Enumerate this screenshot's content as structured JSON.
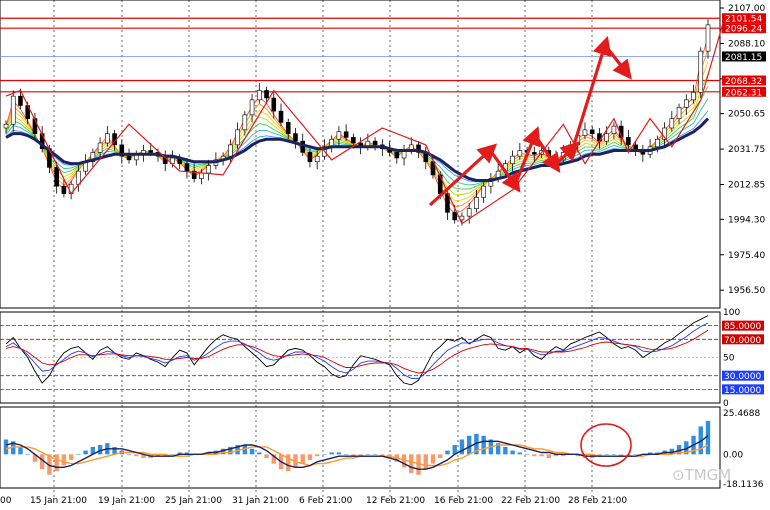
{
  "colors": {
    "background": "#ffffff",
    "panel_bg": "#ffffff",
    "grid": "#000000",
    "candles": "#000000",
    "resistance": "#e60000",
    "annotation": "#e31b1b",
    "current_line": "#6a8cff",
    "current_tag_bg": "#000000",
    "ema_main": "#1c2360",
    "rsi_line": "#000000",
    "rsi_signal_blue": "#1e3cff",
    "rsi_signal_red": "#d40000",
    "level_red": "#d40000",
    "level_blue": "#1e3cff",
    "hist_pos": "#2e8fe0",
    "hist_neg": "#f59a6b",
    "macd_line": "#1c2360",
    "macd_signal": "#ff9a2e"
  },
  "chart_data": [
    {
      "type": "candlestick",
      "panel": "price",
      "x_labels": [
        "15 Jan 21:00",
        "19 Jan 21:00",
        "25 Jan 21:00",
        "31 Jan 21:00",
        "6 Feb 21:00",
        "12 Feb 21:00",
        "16 Feb 21:00",
        "22 Feb 21:00",
        "28 Feb 21:00"
      ],
      "y_ticks": [
        "2107.00",
        "2088.10",
        "2069.20",
        "2050.65",
        "2031.75",
        "2012.85",
        "1994.30",
        "1975.40",
        "1956.50"
      ],
      "ylim": [
        1947.0,
        2107.0
      ],
      "horizontal_levels": [
        {
          "label": "2101.54",
          "value": 2101.54,
          "color": "#e60000"
        },
        {
          "label": "2096.24",
          "value": 2096.24,
          "color": "#e60000"
        },
        {
          "label": "2068.32",
          "value": 2068.32,
          "color": "#e60000"
        },
        {
          "label": "2062.31",
          "value": 2062.31,
          "color": "#e60000"
        }
      ],
      "current_price": {
        "label": "2081.15",
        "value": 2081.15
      },
      "close_path": [
        2045,
        2060,
        2055,
        2048,
        2040,
        2032,
        2022,
        2012,
        2008,
        2013,
        2020,
        2025,
        2030,
        2035,
        2040,
        2034,
        2028,
        2026,
        2029,
        2031,
        2030,
        2028,
        2024,
        2027,
        2024,
        2020,
        2016,
        2019,
        2023,
        2026,
        2028,
        2034,
        2042,
        2050,
        2058,
        2063,
        2059,
        2052,
        2046,
        2040,
        2036,
        2030,
        2025,
        2028,
        2033,
        2037,
        2041,
        2038,
        2035,
        2033,
        2036,
        2034,
        2032,
        2030,
        2027,
        2031,
        2034,
        2030,
        2025,
        2018,
        2008,
        1998,
        1994,
        1996,
        2000,
        2006,
        2012,
        2016,
        2020,
        2024,
        2028,
        2031,
        2030,
        2029,
        2031,
        2028,
        2026,
        2030,
        2034,
        2039,
        2042,
        2040,
        2036,
        2040,
        2044,
        2038,
        2034,
        2031,
        2029,
        2033,
        2037,
        2043,
        2048,
        2054,
        2058,
        2062,
        2084,
        2098
      ],
      "ema_main": [
        2038,
        2040,
        2040,
        2039,
        2037,
        2034,
        2031,
        2028,
        2025,
        2024,
        2024,
        2025,
        2026,
        2027,
        2028,
        2029,
        2029,
        2029,
        2029,
        2029,
        2029,
        2029,
        2028,
        2028,
        2027,
        2026,
        2025,
        2025,
        2025,
        2025,
        2026,
        2027,
        2029,
        2031,
        2034,
        2036,
        2037,
        2037,
        2037,
        2036,
        2035,
        2034,
        2033,
        2032,
        2032,
        2033,
        2033,
        2033,
        2033,
        2033,
        2033,
        2033,
        2033,
        2032,
        2031,
        2031,
        2031,
        2031,
        2030,
        2028,
        2026,
        2023,
        2020,
        2018,
        2016,
        2015,
        2015,
        2015,
        2016,
        2017,
        2019,
        2020,
        2021,
        2022,
        2023,
        2023,
        2023,
        2024,
        2025,
        2026,
        2028,
        2029,
        2029,
        2030,
        2031,
        2031,
        2031,
        2031,
        2031,
        2031,
        2032,
        2033,
        2035,
        2037,
        2039,
        2041,
        2044,
        2048
      ],
      "zigzag": [
        [
          0,
          2060
        ],
        [
          2,
          2063
        ],
        [
          9,
          2008
        ],
        [
          17,
          2045
        ],
        [
          24,
          2020
        ],
        [
          30,
          2018
        ],
        [
          37,
          2063
        ],
        [
          45,
          2026
        ],
        [
          52,
          2043
        ],
        [
          58,
          2034
        ],
        [
          63,
          1992
        ],
        [
          70,
          2010
        ],
        [
          77,
          2045
        ],
        [
          80,
          2024
        ],
        [
          84,
          2048
        ],
        [
          86,
          2030
        ],
        [
          89,
          2048
        ],
        [
          92,
          2033
        ],
        [
          96,
          2058
        ],
        [
          99,
          2098
        ]
      ]
    },
    {
      "type": "line",
      "panel": "oscillator",
      "y_ticks": [
        "100",
        "50",
        "0"
      ],
      "ylim": [
        0,
        100
      ],
      "levels": [
        {
          "label": "85.0000",
          "value": 85,
          "color": "#d40000"
        },
        {
          "label": "70.0000",
          "value": 70,
          "color": "#d40000"
        },
        {
          "label": "30.0000",
          "value": 30,
          "color": "#1e3cff"
        },
        {
          "label": "15.0000",
          "value": 15,
          "color": "#1e3cff"
        }
      ],
      "series": [
        {
          "values": [
            65,
            72,
            60,
            50,
            35,
            22,
            30,
            45,
            55,
            60,
            62,
            55,
            48,
            58,
            62,
            55,
            50,
            48,
            55,
            52,
            48,
            45,
            40,
            50,
            58,
            55,
            42,
            52,
            62,
            70,
            75,
            72,
            70,
            62,
            55,
            48,
            40,
            42,
            50,
            58,
            60,
            58,
            52,
            45,
            40,
            32,
            28,
            30,
            42,
            52,
            50,
            48,
            45,
            42,
            30,
            22,
            20,
            25,
            40,
            55,
            62,
            70,
            68,
            72,
            65,
            70,
            75,
            72,
            60,
            58,
            62,
            55,
            60,
            52,
            48,
            56,
            62,
            58,
            65,
            68,
            72,
            75,
            78,
            72,
            65,
            60,
            62,
            58,
            50,
            55,
            60,
            66,
            70,
            76,
            82,
            88,
            92,
            96
          ],
          "color": "#000000"
        },
        {
          "values": [
            62,
            66,
            60,
            53,
            44,
            35,
            36,
            42,
            48,
            54,
            57,
            55,
            51,
            54,
            57,
            55,
            52,
            50,
            52,
            51,
            49,
            47,
            44,
            47,
            51,
            52,
            47,
            50,
            55,
            61,
            66,
            68,
            68,
            65,
            60,
            55,
            49,
            47,
            49,
            53,
            56,
            56,
            54,
            50,
            46,
            40,
            35,
            33,
            37,
            44,
            46,
            46,
            45,
            44,
            38,
            31,
            27,
            27,
            33,
            42,
            50,
            58,
            62,
            66,
            66,
            68,
            70,
            70,
            66,
            63,
            62,
            59,
            59,
            56,
            53,
            54,
            57,
            57,
            60,
            63,
            66,
            69,
            72,
            71,
            68,
            65,
            64,
            62,
            57,
            56,
            57,
            60,
            63,
            68,
            73,
            79,
            84,
            88
          ],
          "color": "#1e3cff"
        },
        {
          "values": [
            60,
            62,
            60,
            56,
            50,
            44,
            42,
            43,
            46,
            50,
            53,
            53,
            52,
            53,
            54,
            54,
            53,
            52,
            52,
            52,
            51,
            50,
            48,
            48,
            49,
            50,
            49,
            49,
            51,
            55,
            59,
            62,
            64,
            64,
            62,
            59,
            55,
            52,
            51,
            52,
            53,
            54,
            53,
            52,
            50,
            46,
            42,
            39,
            39,
            41,
            43,
            44,
            44,
            44,
            42,
            38,
            35,
            33,
            34,
            37,
            42,
            48,
            53,
            57,
            60,
            62,
            64,
            65,
            64,
            63,
            62,
            60,
            60,
            58,
            56,
            56,
            56,
            56,
            57,
            59,
            61,
            64,
            66,
            67,
            66,
            65,
            64,
            63,
            61,
            59,
            59,
            59,
            60,
            63,
            66,
            70,
            75,
            80
          ],
          "color": "#d40000"
        }
      ]
    },
    {
      "type": "bar",
      "panel": "macd",
      "y_ticks": [
        "25.4688",
        "0.00",
        "-18.1136"
      ],
      "ylim": [
        -18.1136,
        25.4688
      ],
      "histogram": [
        8,
        7,
        4,
        0,
        -4,
        -8,
        -11,
        -9,
        -6,
        -3,
        0,
        2,
        4,
        5,
        6,
        4,
        2,
        0,
        -1,
        -2,
        -2,
        -1,
        -1,
        0,
        1,
        1,
        0,
        0,
        1,
        2,
        3,
        4,
        5,
        5,
        3,
        1,
        -2,
        -5,
        -8,
        -9,
        -7,
        -5,
        -3,
        -1,
        0,
        1,
        1,
        0,
        -1,
        -1,
        0,
        0,
        -1,
        -2,
        -4,
        -7,
        -10,
        -11,
        -8,
        -5,
        -2,
        2,
        5,
        8,
        10,
        11,
        10,
        8,
        6,
        4,
        2,
        1,
        0,
        -1,
        -1,
        -2,
        -1,
        -1,
        0,
        -1,
        -2,
        -2,
        -1,
        0,
        0,
        -1,
        -1,
        0,
        0,
        1,
        1,
        2,
        3,
        5,
        7,
        10,
        15,
        18
      ],
      "macd_line": [
        5,
        6,
        5,
        3,
        0,
        -3,
        -6,
        -7,
        -7,
        -6,
        -4,
        -2,
        0,
        2,
        3,
        3,
        3,
        2,
        1,
        0,
        -1,
        -1,
        -1,
        -1,
        0,
        0,
        0,
        0,
        1,
        1,
        2,
        3,
        4,
        5,
        5,
        4,
        2,
        -1,
        -4,
        -6,
        -7,
        -7,
        -6,
        -4,
        -3,
        -2,
        -1,
        -1,
        -1,
        -1,
        -1,
        -1,
        -1,
        -2,
        -3,
        -5,
        -7,
        -8,
        -8,
        -7,
        -5,
        -3,
        0,
        2,
        4,
        6,
        7,
        7,
        7,
        6,
        5,
        4,
        3,
        2,
        1,
        1,
        0,
        0,
        0,
        0,
        -1,
        -1,
        -1,
        -1,
        -1,
        -1,
        -1,
        -1,
        0,
        0,
        0,
        1,
        1,
        2,
        3,
        5,
        7,
        10
      ],
      "signal_line": [
        3,
        4,
        4,
        4,
        3,
        1,
        -1,
        -3,
        -4,
        -5,
        -5,
        -4,
        -3,
        -2,
        -1,
        0,
        1,
        1,
        1,
        1,
        0,
        0,
        0,
        -1,
        -1,
        -1,
        0,
        0,
        0,
        0,
        1,
        1,
        2,
        3,
        4,
        4,
        4,
        2,
        0,
        -2,
        -4,
        -5,
        -6,
        -5,
        -5,
        -4,
        -3,
        -2,
        -2,
        -1,
        -1,
        -1,
        -1,
        -1,
        -2,
        -3,
        -4,
        -5,
        -6,
        -6,
        -6,
        -5,
        -3,
        -2,
        0,
        2,
        3,
        4,
        5,
        5,
        5,
        5,
        4,
        3,
        3,
        2,
        1,
        1,
        0,
        0,
        0,
        0,
        -1,
        -1,
        -1,
        -1,
        -1,
        -1,
        -1,
        0,
        0,
        0,
        0,
        1,
        1,
        2,
        3,
        5
      ]
    }
  ],
  "watermark": "⊙TMGM"
}
